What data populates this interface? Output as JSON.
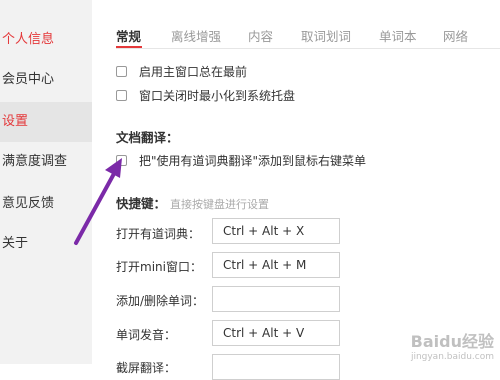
{
  "sidebar": {
    "items": [
      {
        "label": "个人信息"
      },
      {
        "label": "会员中心"
      },
      {
        "label": "设置"
      },
      {
        "label": "满意度调查"
      },
      {
        "label": "意见反馈"
      },
      {
        "label": "关于"
      }
    ]
  },
  "tabs": [
    {
      "label": "常规"
    },
    {
      "label": "离线增强"
    },
    {
      "label": "内容"
    },
    {
      "label": "取词划词"
    },
    {
      "label": "单词本"
    },
    {
      "label": "网络"
    }
  ],
  "general": {
    "options": [
      {
        "label": "启用主窗口总在最前",
        "checked": false
      },
      {
        "label": "窗口关闭时最小化到系统托盘",
        "checked": false
      }
    ]
  },
  "doc_translate": {
    "title": "文档翻译：",
    "option": {
      "label": "把\"使用有道词典翻译\"添加到鼠标右键菜单",
      "checked": false
    }
  },
  "shortcuts": {
    "title": "快捷键：",
    "hint": "直接按键盘进行设置",
    "items": [
      {
        "label": "打开有道词典：",
        "value": "Ctrl + Alt + X"
      },
      {
        "label": "打开mini窗口：",
        "value": "Ctrl + Alt + M"
      },
      {
        "label": "添加/删除单词：",
        "value": ""
      },
      {
        "label": "单词发音：",
        "value": "Ctrl + Alt + V"
      },
      {
        "label": "截屏翻译：",
        "value": ""
      }
    ]
  },
  "colors": {
    "accent": "#e4383a",
    "annotation_arrow": "#7b2aa8"
  },
  "watermark": {
    "text": "Baidu经验",
    "sub": "jingyan.baidu.com"
  }
}
